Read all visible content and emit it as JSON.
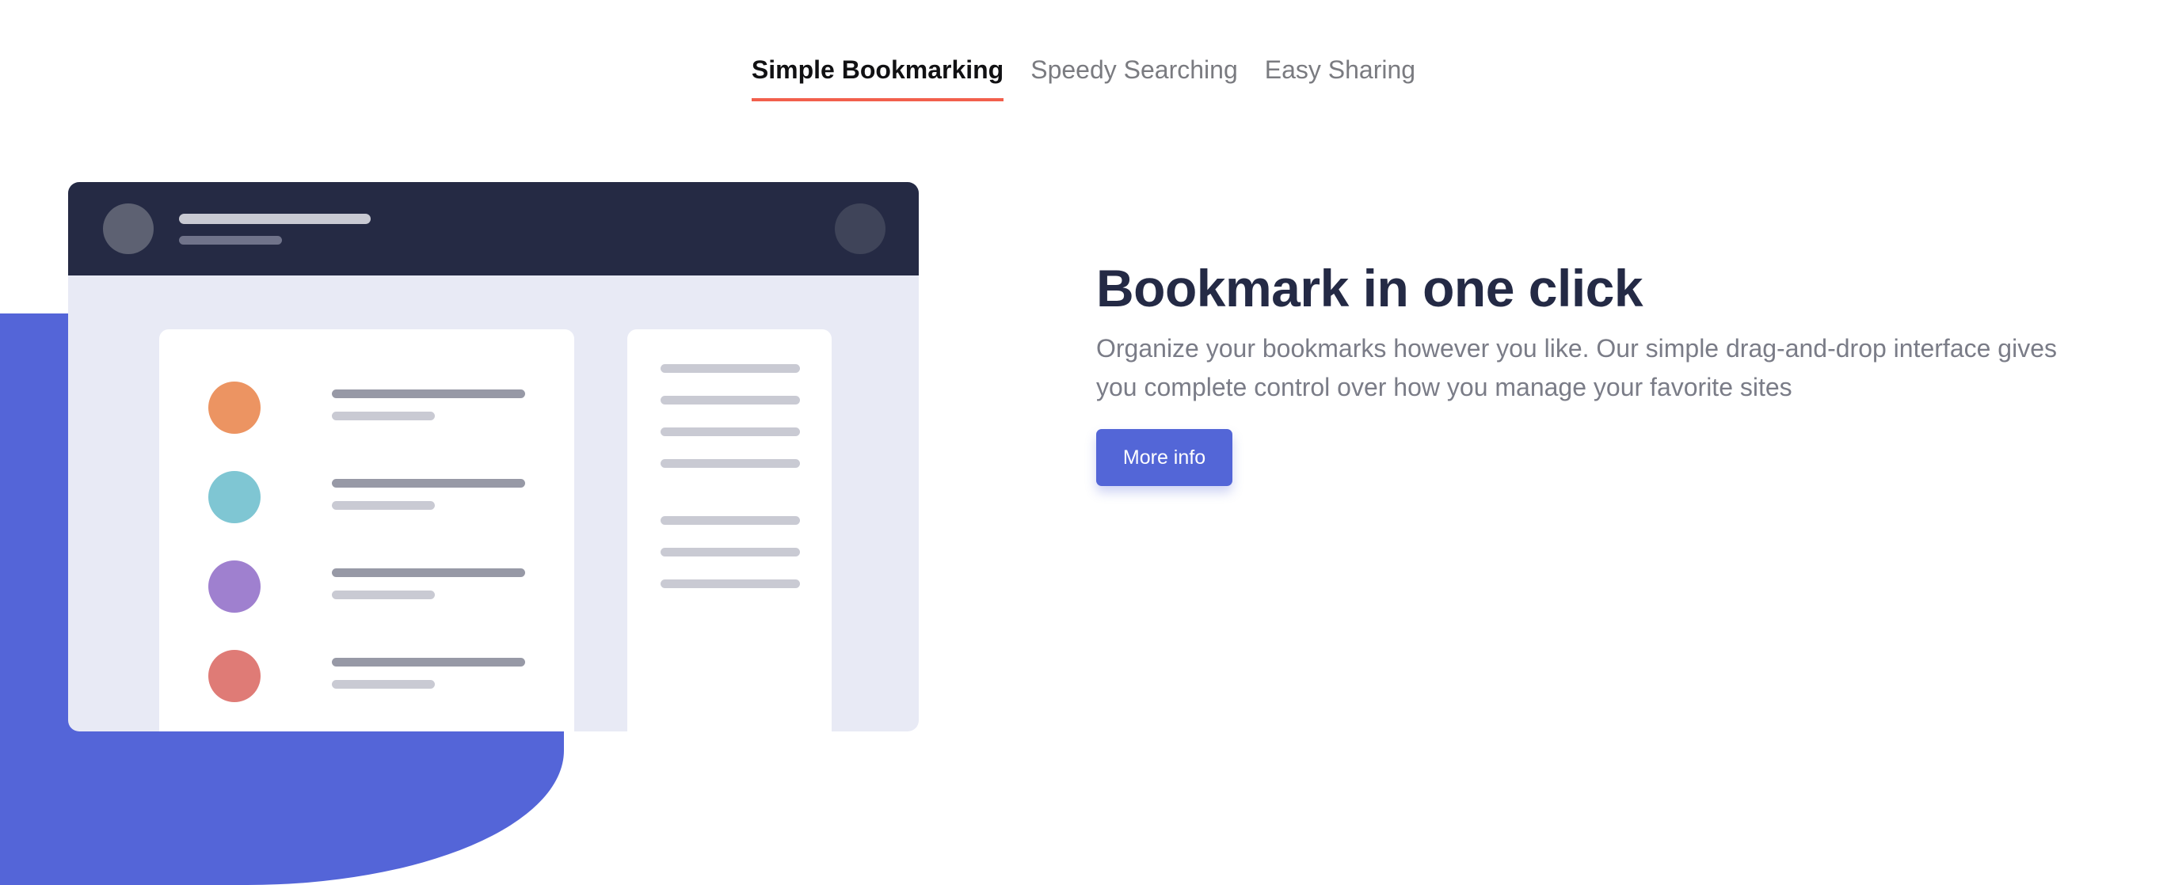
{
  "tabs": [
    {
      "label": "Simple Bookmarking",
      "active": true
    },
    {
      "label": "Speedy Searching",
      "active": false
    },
    {
      "label": "Easy Sharing",
      "active": false
    }
  ],
  "feature": {
    "title": "Bookmark in one click",
    "description": "Organize your bookmarks however you like. Our simple drag-and-drop interface gives you complete control over how you manage your favorite sites",
    "button_label": "More info"
  },
  "illustration": {
    "bookmark_dot_colors": [
      "#ec9462",
      "#7fc6d3",
      "#9f80cf",
      "#df7b76"
    ]
  },
  "colors": {
    "accent": "#5366d7",
    "tab_underline": "#f25f4c",
    "heading": "#242a45"
  }
}
